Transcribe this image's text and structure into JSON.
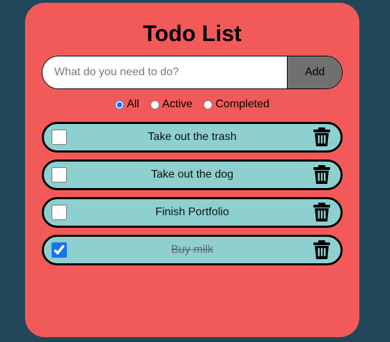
{
  "app": {
    "title": "Todo List"
  },
  "add": {
    "placeholder": "What do you need to do?",
    "button_label": "Add"
  },
  "filters": {
    "selected": "All",
    "options": [
      {
        "label": "All",
        "checked": true
      },
      {
        "label": "Active",
        "checked": false
      },
      {
        "label": "Completed",
        "checked": false
      }
    ]
  },
  "todos": [
    {
      "text": "Take out the trash",
      "completed": false,
      "icon": "trash-icon"
    },
    {
      "text": "Take out the dog",
      "completed": false,
      "icon": "trash-icon"
    },
    {
      "text": "Finish Portfolio",
      "completed": false,
      "icon": "trash-icon"
    },
    {
      "text": "Buy milk",
      "completed": true,
      "icon": "trash-icon"
    }
  ],
  "colors": {
    "background": "#21465a",
    "card": "#f25a5a",
    "item": "#8ecfcf",
    "add_button": "#707070",
    "accent": "#1a73e8"
  }
}
